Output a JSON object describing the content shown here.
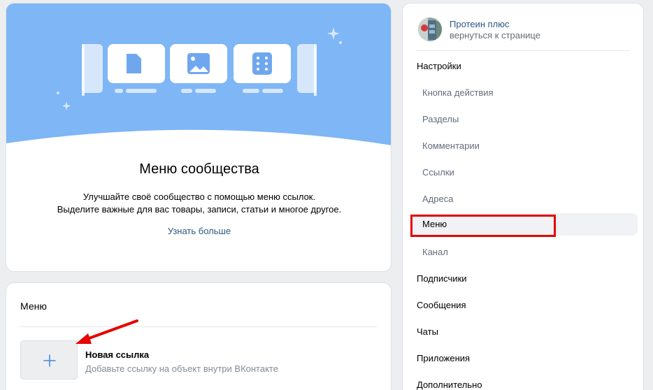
{
  "hero": {
    "title": "Меню сообщества",
    "description_line1": "Улучшайте своё сообщество с помощью меню ссылок.",
    "description_line2": "Выделите важные для вас товары, записи, статьи и многое другое.",
    "learn_more": "Узнать больше"
  },
  "menu_card": {
    "title": "Меню",
    "new_link_title": "Новая ссылка",
    "new_link_desc": "Добавьте ссылку на объект внутри ВКонтакте"
  },
  "sidebar": {
    "group_name": "Протеин плюс",
    "back_label": "вернуться к странице",
    "items": [
      {
        "label": "Настройки",
        "level": "top"
      },
      {
        "label": "Кнопка действия",
        "level": "sub"
      },
      {
        "label": "Разделы",
        "level": "sub"
      },
      {
        "label": "Комментарии",
        "level": "sub"
      },
      {
        "label": "Ссылки",
        "level": "sub"
      },
      {
        "label": "Адреса",
        "level": "sub"
      },
      {
        "label": "Меню",
        "level": "sub",
        "active": true
      },
      {
        "label": "Канал",
        "level": "sub"
      },
      {
        "label": "Подписчики",
        "level": "top"
      },
      {
        "label": "Сообщения",
        "level": "top"
      },
      {
        "label": "Чаты",
        "level": "top"
      },
      {
        "label": "Приложения",
        "level": "top"
      },
      {
        "label": "Дополнительно",
        "level": "top"
      }
    ]
  },
  "colors": {
    "banner": "#7eb6f6",
    "link": "#2a5885",
    "highlight": "#e60000"
  }
}
